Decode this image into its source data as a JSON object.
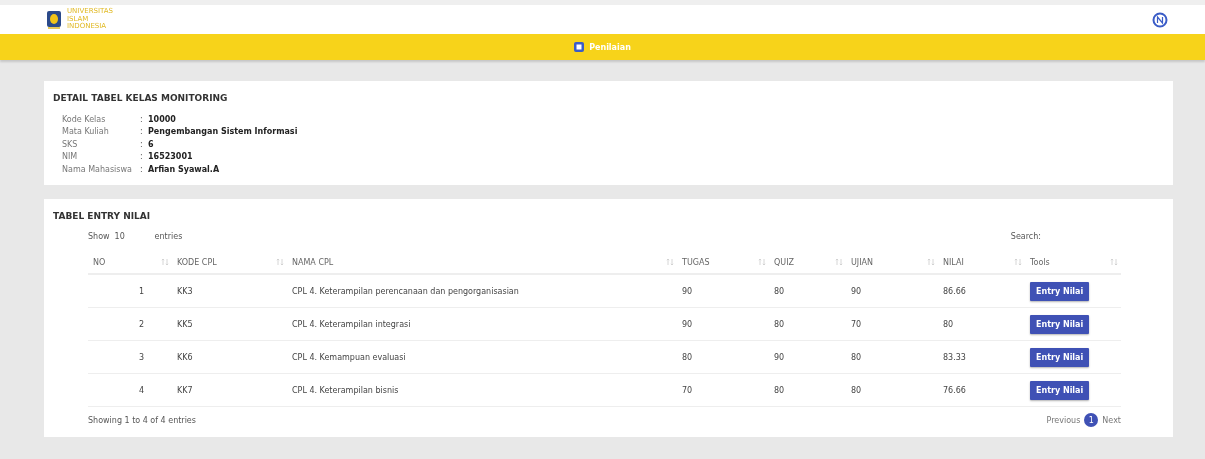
{
  "header": {
    "logo_lines": [
      "UNIVERSITAS",
      "ISLAM",
      "INDONESIA"
    ],
    "nav_item": "Penilaian"
  },
  "detail": {
    "title": "DETAIL TABEL KELAS MONITORING",
    "separator": ":",
    "fields": [
      {
        "label": "Kode Kelas",
        "value": "10000"
      },
      {
        "label": "Mata Kuliah",
        "value": "Pengembangan Sistem Informasi"
      },
      {
        "label": "SKS",
        "value": "6"
      },
      {
        "label": "NIM",
        "value": "16523001"
      },
      {
        "label": "Nama Mahasiswa",
        "value": "Arfian Syawal.A"
      }
    ]
  },
  "entry": {
    "title": "TABEL ENTRY NILAI",
    "show_label": "Show",
    "show_value": "10",
    "entries_label": "entries",
    "search_label": "Search:",
    "columns": [
      "NO",
      "KODE CPL",
      "NAMA CPL",
      "TUGAS",
      "QUIZ",
      "UJIAN",
      "NILAI",
      "Tools"
    ],
    "rows": [
      {
        "no": "1",
        "kode": "KK3",
        "nama": "CPL 4. Keterampilan perencanaan dan pengorganisasian",
        "tugas": "90",
        "quiz": "80",
        "ujian": "90",
        "nilai": "86.66",
        "action": "Entry Nilai"
      },
      {
        "no": "2",
        "kode": "KK5",
        "nama": "CPL 4. Keterampilan integrasi",
        "tugas": "90",
        "quiz": "80",
        "ujian": "70",
        "nilai": "80",
        "action": "Entry Nilai"
      },
      {
        "no": "3",
        "kode": "KK6",
        "nama": "CPL 4. Kemampuan evaluasi",
        "tugas": "80",
        "quiz": "90",
        "ujian": "80",
        "nilai": "83.33",
        "action": "Entry Nilai"
      },
      {
        "no": "4",
        "kode": "KK7",
        "nama": "CPL 4. Keterampilan bisnis",
        "tugas": "70",
        "quiz": "80",
        "ujian": "80",
        "nilai": "76.66",
        "action": "Entry Nilai"
      }
    ],
    "info": "Showing 1 to 4 of 4 entries",
    "previous": "Previous",
    "pages": [
      {
        "label": "1",
        "selected": true
      }
    ],
    "next": "Next"
  }
}
